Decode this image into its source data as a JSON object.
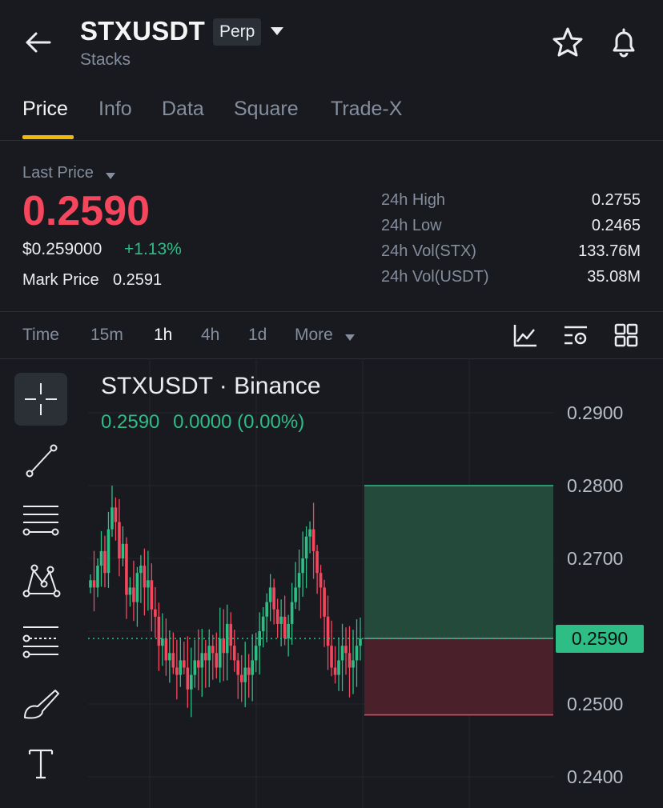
{
  "header": {
    "symbol": "STXUSDT",
    "badge": "Perp",
    "subtitle": "Stacks",
    "icons": [
      "arrow-left-icon",
      "caret-down-icon",
      "star-icon",
      "bell-icon"
    ]
  },
  "tabs": [
    "Price",
    "Info",
    "Data",
    "Square",
    "Trade-X"
  ],
  "price": {
    "last_label": "Last Price",
    "last": "0.2590",
    "usd": "$0.259000",
    "change": "+1.13%",
    "mark_label": "Mark Price",
    "mark": "0.2591"
  },
  "stats": [
    {
      "label": "24h High",
      "value": "0.2755"
    },
    {
      "label": "24h Low",
      "value": "0.2465"
    },
    {
      "label": "24h Vol(STX)",
      "value": "133.76M"
    },
    {
      "label": "24h Vol(USDT)",
      "value": "35.08M"
    }
  ],
  "intervals": [
    "Time",
    "15m",
    "1h",
    "4h",
    "1d",
    "More"
  ],
  "chart": {
    "title": "STXUSDT · Binance",
    "ohlc_price": "0.2590",
    "ohlc_change": "0.0000 (0.00%)",
    "y_labels": [
      "0.2900",
      "0.2800",
      "0.2700",
      "0.2500",
      "0.2400"
    ],
    "current_tag": "0.2590",
    "colors": {
      "up": "#2ebd85",
      "down": "#f6465d",
      "accent": "#f0b90b"
    },
    "position": {
      "entry": 0.259,
      "take_profit": 0.28,
      "stop_loss": 0.2485
    }
  },
  "chart_data": {
    "type": "candlestick",
    "y_axis_ticks": [
      0.24,
      0.25,
      0.26,
      0.27,
      0.28,
      0.29
    ],
    "last_price": 0.259,
    "close_approx": [
      0.267,
      0.266,
      0.269,
      0.271,
      0.268,
      0.274,
      0.277,
      0.275,
      0.27,
      0.272,
      0.265,
      0.266,
      0.264,
      0.268,
      0.269,
      0.266,
      0.267,
      0.263,
      0.262,
      0.258,
      0.259,
      0.256,
      0.257,
      0.255,
      0.254,
      0.256,
      0.255,
      0.252,
      0.254,
      0.256,
      0.255,
      0.257,
      0.256,
      0.258,
      0.257,
      0.255,
      0.259,
      0.257,
      0.261,
      0.258,
      0.256,
      0.254,
      0.253,
      0.255,
      0.254,
      0.256,
      0.258,
      0.26,
      0.262,
      0.264,
      0.266,
      0.263,
      0.261,
      0.262,
      0.259,
      0.261,
      0.264,
      0.266,
      0.268,
      0.27,
      0.273,
      0.274,
      0.271,
      0.268,
      0.266,
      0.262,
      0.258,
      0.255,
      0.254,
      0.256,
      0.258,
      0.257,
      0.255,
      0.256,
      0.258,
      0.259
    ]
  }
}
